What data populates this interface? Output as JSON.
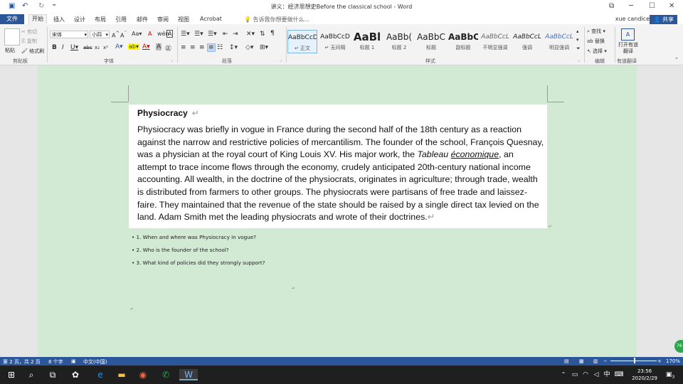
{
  "titlebar": {
    "doc_title": "讲义：经济思想史Before the classical school - Word"
  },
  "tabs": {
    "file": "文件",
    "items": [
      "开始",
      "插入",
      "设计",
      "布局",
      "引用",
      "邮件",
      "审阅",
      "视图",
      "Acrobat"
    ],
    "tell_me": "告诉我你想要做什么...",
    "user": "xue candice",
    "share": "共享"
  },
  "ribbon": {
    "clipboard": {
      "paste": "粘贴",
      "cut": "剪切",
      "copy": "复制",
      "format_painter": "格式刷",
      "label": "剪贴板"
    },
    "font": {
      "name": "宋体",
      "size": "小四",
      "label": "字体"
    },
    "paragraph": {
      "label": "段落"
    },
    "styles": {
      "label": "样式",
      "items": [
        {
          "preview": "AaBbCcD",
          "name": "↵ 正文"
        },
        {
          "preview": "AaBbCcD",
          "name": "↵ 无间隔"
        },
        {
          "preview": "AaBl",
          "name": "标题 1"
        },
        {
          "preview": "AaBb(",
          "name": "标题 2"
        },
        {
          "preview": "AaBbC",
          "name": "标题"
        },
        {
          "preview": "AaBbC",
          "name": "副标题"
        },
        {
          "preview": "AaBbCcL",
          "name": "不明显强调"
        },
        {
          "preview": "AaBbCcL",
          "name": "强调"
        },
        {
          "preview": "AaBbCcL",
          "name": "明显强调"
        }
      ]
    },
    "editing": {
      "find": "查找",
      "replace": "替换",
      "select": "选择",
      "label": "编辑"
    },
    "translate": {
      "btn": "打开有道翻译",
      "label": "有道翻译"
    }
  },
  "document": {
    "heading": "Physiocracy",
    "para_part1": "Physiocracy was briefly in vogue in France during the second half of the 18th century as a reaction against the narrow and restrictive policies of mercantilism. The founder of the school, François Quesnay, was a physician at the royal court of King Louis XV. His major work, the ",
    "para_italic1": "Tableau ",
    "para_italic2": "économique",
    "para_part2": ", an attempt to trace income flows through the economy, crudely anticipated 20th-century national income accounting. All wealth, in the doctrine of the physiocrats, originates in agriculture; through trade, wealth is distributed from farmers to other groups. The physiocrats were partisans of free trade and laissez-faire. They maintained that the revenue of the state should be raised by a single direct tax levied on the land. Adam Smith met the leading physiocrats and wrote of their doctrines.",
    "questions": [
      "• 1. When and where was Physiocracy in vogue?",
      "• 2. Who is the founder of the school?",
      "• 3. What kind of policies did they strongly support?"
    ]
  },
  "status": {
    "page": "第 2 页，共 2 页",
    "words": "8 个字",
    "lang": "中文(中国)",
    "zoom": "170%"
  },
  "taskbar": {
    "time": "23:56",
    "date": "2020/2/29",
    "ime": "中",
    "notif": "3"
  }
}
